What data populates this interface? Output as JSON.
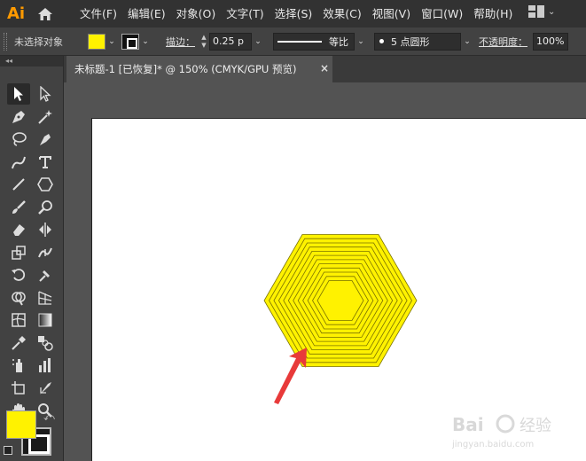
{
  "app": {
    "logo": "Ai",
    "menu": [
      "文件(F)",
      "编辑(E)",
      "对象(O)",
      "文字(T)",
      "选择(S)",
      "效果(C)",
      "视图(V)",
      "窗口(W)",
      "帮助(H)"
    ]
  },
  "control_bar": {
    "selection_status": "未选择对象",
    "fill_color": "#fff200",
    "stroke_label": "描边：",
    "stroke_value": "0.25 p",
    "profile_label": "等比",
    "brush_label": "5 点圆形",
    "opacity_label": "不透明度：",
    "opacity_value": "100%"
  },
  "document_tab": {
    "title": "未标题-1 [已恢复]* @ 150% (CMYK/GPU 预览)",
    "close": "×"
  },
  "toolbar": {
    "collapse": "◂◂",
    "tools": [
      "selection-tool",
      "direct-selection-tool",
      "pen-tool",
      "magic-wand-tool",
      "lasso-tool",
      "curvature-tool",
      "pencil-tool",
      "type-tool",
      "line-segment-tool",
      "polygon-tool",
      "paintbrush-tool",
      "blob-brush-tool",
      "eraser-tool",
      "reflect-tool",
      "scale-tool",
      "width-tool",
      "rotate-tool",
      "puppet-warp-tool",
      "shape-builder-tool",
      "perspective-grid-tool",
      "mesh-tool",
      "gradient-tool",
      "eyedropper-tool",
      "blend-tool",
      "symbol-sprayer-tool",
      "column-graph-tool",
      "artboard-tool",
      "slice-tool",
      "hand-tool",
      "zoom-tool"
    ],
    "fill_color": "#fff200",
    "stroke_color": "#1a1a1a"
  },
  "artwork": {
    "shape": "concentric hexagons",
    "fill_color": "#fff200",
    "stroke_color": "#7a7200",
    "hexagon_count": 12,
    "arrow_color": "#e83a3a"
  },
  "watermark": {
    "brand": "Bai",
    "brand2": "经验",
    "url": "jingyan.baidu.com"
  }
}
